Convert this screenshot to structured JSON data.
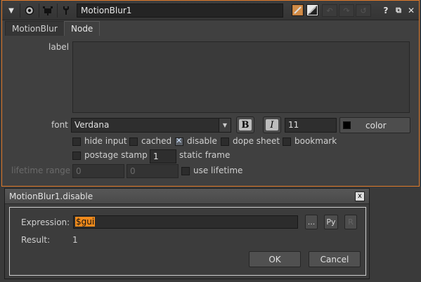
{
  "toolbar": {
    "collapse_icon": "triangle-down-icon",
    "node_name": "MotionBlur1"
  },
  "tabs": [
    {
      "label": "MotionBlur",
      "active": false
    },
    {
      "label": "Node",
      "active": true
    }
  ],
  "node": {
    "label_label": "label",
    "label_value": "",
    "font_label": "font",
    "font_value": "Verdana",
    "bold_label": "B",
    "italic_label": "I",
    "font_size": "11",
    "color_label": "color",
    "color_swatch": "#000000",
    "hide_input": {
      "label": "hide input",
      "checked": false
    },
    "cached": {
      "label": "cached",
      "checked": false
    },
    "disable": {
      "label": "disable",
      "checked": true
    },
    "dope_sheet": {
      "label": "dope sheet",
      "checked": false
    },
    "bookmark": {
      "label": "bookmark",
      "checked": false
    },
    "postage_stamp": {
      "label": "postage stamp",
      "checked": false
    },
    "static_frame_value": "1",
    "static_frame_label": "static frame",
    "lifetime_range_label": "lifetime range",
    "lifetime_start": "0",
    "lifetime_end": "0",
    "use_lifetime": {
      "label": "use lifetime",
      "checked": false
    }
  },
  "dialog": {
    "title": "MotionBlur1.disable",
    "close_label": "x",
    "expression_label": "Expression:",
    "expression_value": "$gui",
    "ellipsis_label": "...",
    "py_label": "Py",
    "r_label": "R",
    "result_label": "Result:",
    "result_value": "1",
    "ok_label": "OK",
    "cancel_label": "Cancel"
  },
  "colors": {
    "accent_border": "#e07a2a",
    "selection": "#f08a1c"
  }
}
